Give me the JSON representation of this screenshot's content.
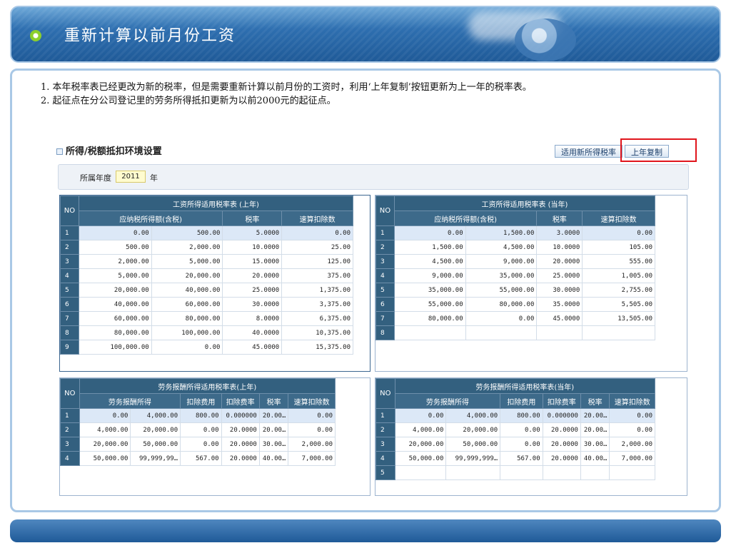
{
  "slide": {
    "title": "重新计算以前月份工资",
    "note1": "1. 本年税率表已经更改为新的税率，但是需要重新计算以前月份的工资时，利用‘上年复制’按钮更新为上一年的税率表。",
    "note2": "2. 起征点在分公司登记里的劳务所得抵扣更新为以前2000元的起征点。"
  },
  "section": {
    "title": "所得/税额抵扣环境设置"
  },
  "toolbar": {
    "apply_new_label": "适用新所得税率",
    "copy_prev_label": "上年复制"
  },
  "year": {
    "label": "所属年度",
    "value": "2011",
    "unit": "年"
  },
  "wage_prev": {
    "title": "工资所得适用税率表 (上年)",
    "headers": [
      "NO",
      "应纳税所得额(含税)",
      "税率",
      "速算扣除数"
    ],
    "rows": [
      [
        "1",
        "0.00",
        "500.00",
        "5.0000",
        "0.00"
      ],
      [
        "2",
        "500.00",
        "2,000.00",
        "10.0000",
        "25.00"
      ],
      [
        "3",
        "2,000.00",
        "5,000.00",
        "15.0000",
        "125.00"
      ],
      [
        "4",
        "5,000.00",
        "20,000.00",
        "20.0000",
        "375.00"
      ],
      [
        "5",
        "20,000.00",
        "40,000.00",
        "25.0000",
        "1,375.00"
      ],
      [
        "6",
        "40,000.00",
        "60,000.00",
        "30.0000",
        "3,375.00"
      ],
      [
        "7",
        "60,000.00",
        "80,000.00",
        "8.0000",
        "6,375.00"
      ],
      [
        "8",
        "80,000.00",
        "100,000.00",
        "40.0000",
        "10,375.00"
      ],
      [
        "9",
        "100,000.00",
        "0.00",
        "45.0000",
        "15,375.00"
      ]
    ]
  },
  "wage_curr": {
    "title": "工资所得适用税率表 (当年)",
    "headers": [
      "NO",
      "应纳税所得额(含税)",
      "税率",
      "速算扣除数"
    ],
    "rows": [
      [
        "1",
        "0.00",
        "1,500.00",
        "3.0000",
        "0.00"
      ],
      [
        "2",
        "1,500.00",
        "4,500.00",
        "10.0000",
        "105.00"
      ],
      [
        "3",
        "4,500.00",
        "9,000.00",
        "20.0000",
        "555.00"
      ],
      [
        "4",
        "9,000.00",
        "35,000.00",
        "25.0000",
        "1,005.00"
      ],
      [
        "5",
        "35,000.00",
        "55,000.00",
        "30.0000",
        "2,755.00"
      ],
      [
        "6",
        "55,000.00",
        "80,000.00",
        "35.0000",
        "5,505.00"
      ],
      [
        "7",
        "80,000.00",
        "0.00",
        "45.0000",
        "13,505.00"
      ],
      [
        "8",
        "",
        "",
        "",
        ""
      ]
    ]
  },
  "labor_prev": {
    "title": "劳务报酬所得适用税率表(上年)",
    "headers": [
      "NO",
      "劳务报酬所得",
      "扣除费用",
      "扣除费率",
      "税率",
      "速算扣除数"
    ],
    "rows": [
      [
        "1",
        "0.00",
        "4,000.00",
        "800.00",
        "0.000000",
        "20.00…",
        "0.00"
      ],
      [
        "2",
        "4,000.00",
        "20,000.00",
        "0.00",
        "20.0000",
        "20.00…",
        "0.00"
      ],
      [
        "3",
        "20,000.00",
        "50,000.00",
        "0.00",
        "20.0000",
        "30.00…",
        "2,000.00"
      ],
      [
        "4",
        "50,000.00",
        "99,999,99…",
        "567.00",
        "20.0000",
        "40.00…",
        "7,000.00"
      ]
    ]
  },
  "labor_curr": {
    "title": "劳务报酬所得适用税率表(当年)",
    "headers": [
      "NO",
      "劳务报酬所得",
      "扣除费用",
      "扣除费率",
      "税率",
      "速算扣除数"
    ],
    "rows": [
      [
        "1",
        "0.00",
        "4,000.00",
        "800.00",
        "0.000000",
        "20.00…",
        "0.00"
      ],
      [
        "2",
        "4,000.00",
        "20,000.00",
        "0.00",
        "20.0000",
        "20.00…",
        "0.00"
      ],
      [
        "3",
        "20,000.00",
        "50,000.00",
        "0.00",
        "20.0000",
        "30.00…",
        "2,000.00"
      ],
      [
        "4",
        "50,000.00",
        "99,999,999…",
        "567.00",
        "20.0000",
        "40.00…",
        "7,000.00"
      ],
      [
        "5",
        "",
        "",
        "",
        "",
        "",
        ""
      ]
    ]
  },
  "colors": {
    "header_blue": "#2e6fb0",
    "table_header": "#33607f",
    "highlight_red": "#e0151c",
    "year_input_bg": "#fffbcf"
  }
}
